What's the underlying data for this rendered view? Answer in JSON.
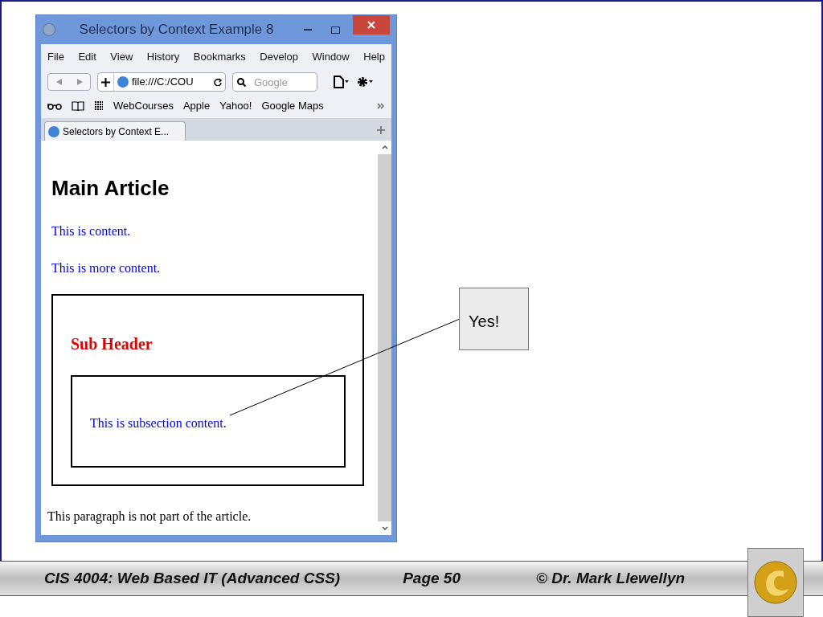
{
  "browser": {
    "title": "Selectors by Context Example 8",
    "menu": [
      "File",
      "Edit",
      "View",
      "History",
      "Bookmarks",
      "Develop",
      "Window",
      "Help"
    ],
    "address": "file:///C:/COU",
    "search": {
      "placeholder": "Google"
    },
    "bookmarks": [
      "WebCourses",
      "Apple",
      "Yahoo!",
      "Google Maps"
    ],
    "tab": {
      "label": "Selectors by Context E...",
      "selected": true
    },
    "page": {
      "heading": "Main Article",
      "paragraphs": [
        "This is content.",
        "This is more content."
      ],
      "sub_header": "Sub Header",
      "subsection": "This is subsection content.",
      "outside": "This paragraph is not part of the article."
    }
  },
  "callout": "Yes!",
  "footer": {
    "course": "CIS 4004: Web Based IT (Advanced CSS)",
    "page": "Page 50",
    "author": "© Dr. Mark Llewellyn"
  }
}
